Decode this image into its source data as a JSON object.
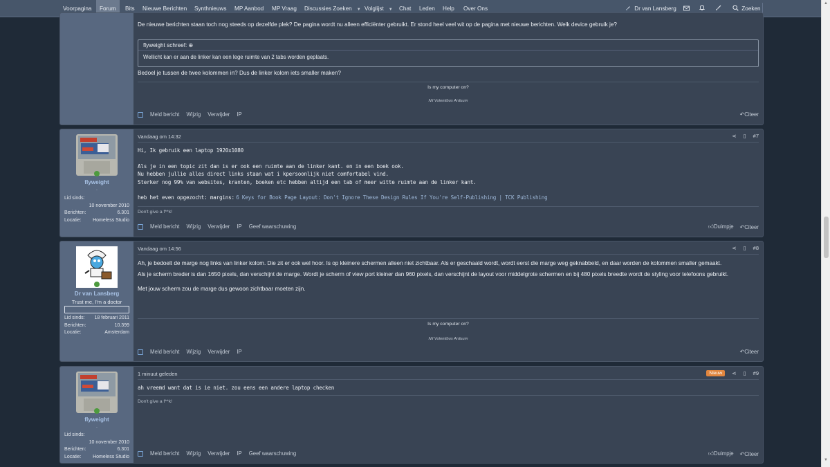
{
  "nav": {
    "tabs": [
      "Voorpagina",
      "Forum",
      "Bits",
      "Nieuwe Berichten",
      "Synthnieuws",
      "MP Aanbod",
      "MP Vraag",
      "Discussies Zoeken",
      "Volglijst",
      "Chat",
      "Leden",
      "Help",
      "Over Ons"
    ],
    "user": "Dr van Lansberg",
    "search": "Zoeken"
  },
  "colors": {
    "nav": "#47566a",
    "post": "#394454",
    "usercell": "#586880",
    "username": "#a9c3e6",
    "new_badge": "#e1863e",
    "checkbox": "#7aa6d8"
  },
  "post0": {
    "p1": "De nieuwe berichten staan toch nog steeds op dezelfde plek? De pagina wordt nu alleen efficiënter gebruikt. Er stond heel veel wit op de pagina met nieuwe berichten. Welk device gebruik je?",
    "quote_author": "flyweight schreef:",
    "quote_text": "Wellicht kan er aan de linker kan een lege ruimte van 2 tabs worden geplaats.",
    "p2": "Bedoel je tussen de twee kolommen in? Dus de linker kolom iets smaller maken?",
    "sig1": "Is my computer on?",
    "sig2": "Nil Volentibus Arduum",
    "actions": [
      "Meld bericht",
      "Wijzig",
      "Verwijder",
      "IP"
    ],
    "reply": "Citeer"
  },
  "post7": {
    "time": "Vandaag om 14:32",
    "num": "#7",
    "user": "flyweight",
    "title": ".",
    "joined_label": "Lid sinds:",
    "joined": "10 november 2010",
    "posts_label": "Berichten:",
    "posts": "6.301",
    "loc_label": "Locatie:",
    "loc": "Homeless Studio",
    "l1": "Hi, Ik gebruik een laptop 1920x1080",
    "l2": "Als je in een topic zit dan is er ook een ruimte aan de linker kant. en in een boek ook.",
    "l3": "Nu hebben jullie alles direct links staan wat i kpersoonlijk niet comfortabel vind.",
    "l4": "Sterker nog 99% van websites, kranten, boeken etc hebben altijd een tab of meer witte ruimte aan de linker kant.",
    "l5a": "heb het even opgezocht: margins:",
    "l5b": "6 Keys for Book Page Layout: Don't Ignore These Design Rules If You're Self-Publishing | TCK Publishing",
    "sig": "Don't give a f**k!",
    "actions": [
      "Meld bericht",
      "Wijzig",
      "Verwijder",
      "IP",
      "Geef waarschuwing"
    ],
    "like": "Duimpje",
    "reply": "Citeer"
  },
  "post8": {
    "time": "Vandaag om 14:56",
    "num": "#8",
    "user": "Dr van Lansberg",
    "title": "Trust me, I'm a doctor",
    "joined_label": "Lid sinds:",
    "joined": "18 februari 2011",
    "posts_label": "Berichten:",
    "posts": "10.399",
    "loc_label": "Locatie:",
    "loc": "Amsterdam",
    "p1": "Ah, je bedoelt de marge nog links van linker kolom. Die zit er ook wel hoor. Is op kleinere schermen alleen niet zichtbaar. Als er geschaald wordt, wordt eerst die marge weg geknabbeld, en daar worden de kolommen smaller gemaakt.",
    "p2": "Als je scherm breder is dan 1650 pixels, dan verschijnt de marge. Wordt je scherm of view port kleiner dan 960 pixels, dan verschijnt de layout voor middelgrote schermen en bij 480 pixels breedte wordt de styling voor telefoons gebruikt.",
    "p3": "Met jouw scherm zou de marge dus gewoon zichtbaar moeten zijn.",
    "sig1": "Is my computer on?",
    "sig2": "Nil Volentibus Arduum",
    "actions": [
      "Meld bericht",
      "Wijzig",
      "Verwijder",
      "IP"
    ],
    "reply": "Citeer"
  },
  "post9": {
    "time": "1 minuut geleden",
    "badge": "Nieuw",
    "num": "#9",
    "user": "flyweight",
    "title": ".",
    "joined_label": "Lid sinds:",
    "joined": "10 november 2010",
    "posts_label": "Berichten:",
    "posts": "6.301",
    "loc_label": "Locatie:",
    "loc": "Homeless Studio",
    "p1": "ah vreemd want dat is ie niet. zou eens een andere laptop checken",
    "sig": "Don't give a f**k!",
    "actions": [
      "Meld bericht",
      "Wijzig",
      "Verwijder",
      "IP",
      "Geef waarschuwing"
    ],
    "like": "Duimpje",
    "reply": "Citeer"
  }
}
